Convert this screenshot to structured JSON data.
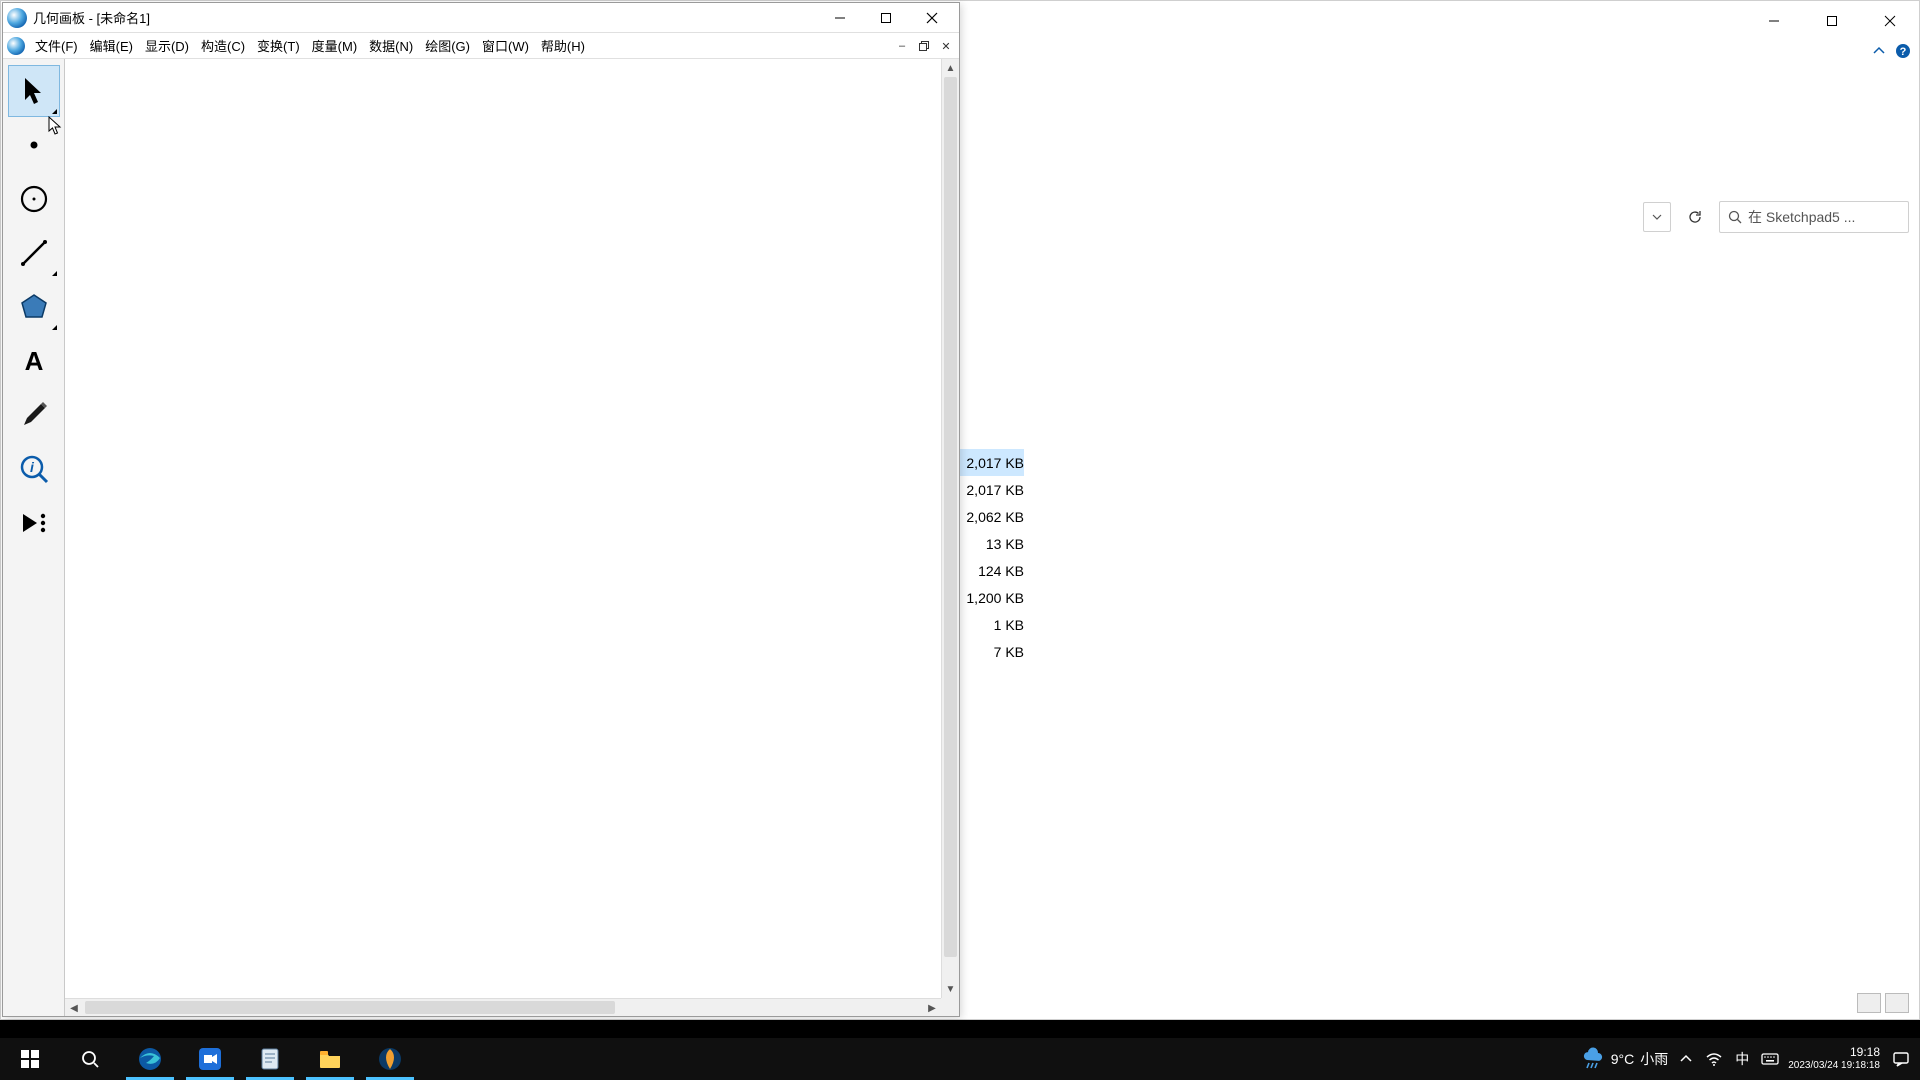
{
  "sketchpad": {
    "title": "几何画板 - [未命名1]",
    "menus": {
      "file": "文件(F)",
      "edit": "编辑(E)",
      "display": "显示(D)",
      "construct": "构造(C)",
      "transform": "变换(T)",
      "measure": "度量(M)",
      "number": "数据(N)",
      "graph": "绘图(G)",
      "window": "窗口(W)",
      "help": "帮助(H)"
    },
    "tools": {
      "arrow": "selection-arrow",
      "point": "point",
      "circle": "compass",
      "line": "straightedge",
      "polygon": "polygon",
      "text": "text",
      "marker": "marker",
      "info": "information",
      "custom": "custom-tools"
    }
  },
  "explorer": {
    "search_placeholder": "在 Sketchpad5 ...",
    "file_sizes": [
      "2,017 KB",
      "2,017 KB",
      "2,062 KB",
      "13 KB",
      "124 KB",
      "1,200 KB",
      "1 KB",
      "7 KB"
    ],
    "selected_index": 0
  },
  "taskbar": {
    "weather_temp": "9°C",
    "weather_text": "小雨",
    "ime": "中",
    "time": "19:18",
    "date": "2023/03/24",
    "date_full": "2023/03/24 19:18:18"
  }
}
